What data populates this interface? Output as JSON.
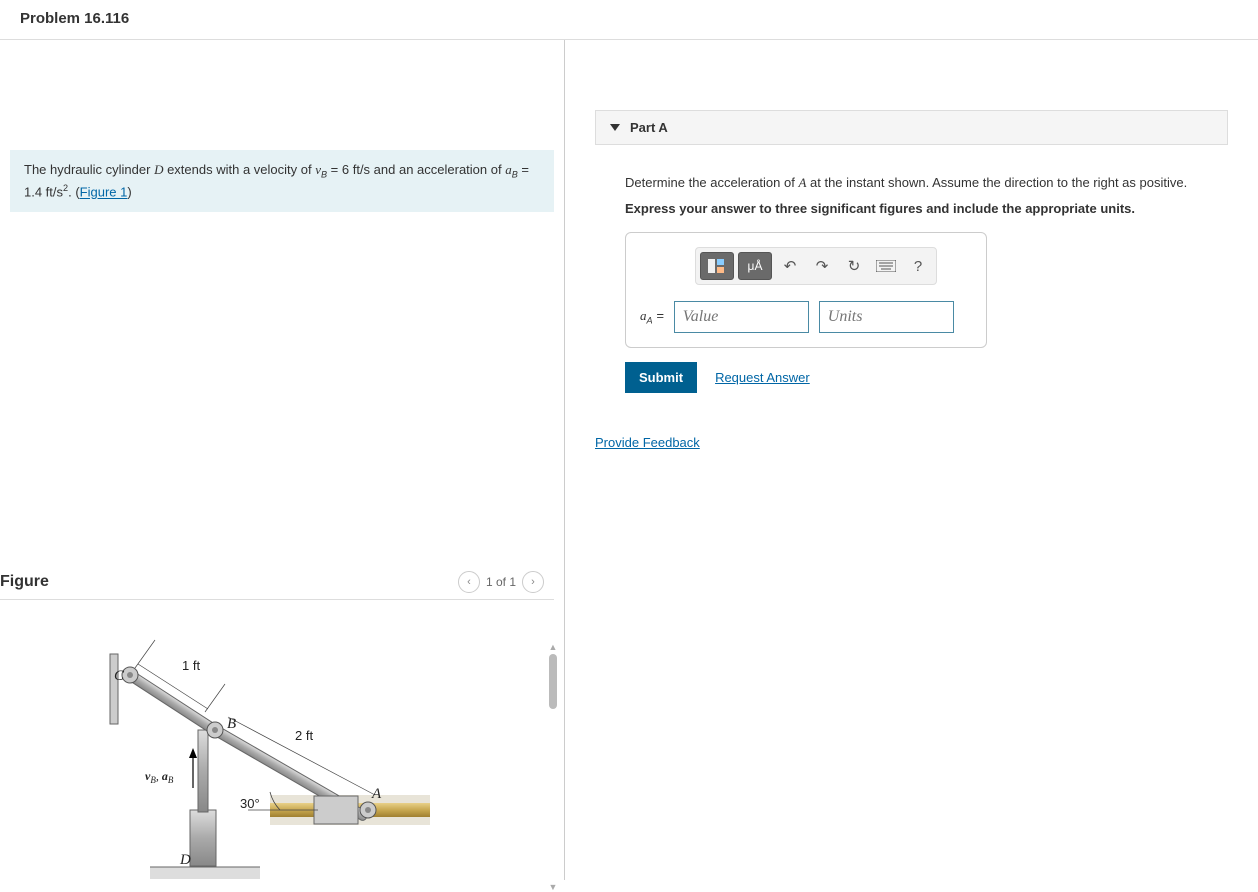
{
  "header": {
    "title": "Problem 16.116"
  },
  "problem": {
    "text_pre": "The hydraulic cylinder ",
    "sym_D": "D",
    "text_mid1": " extends with a velocity of ",
    "sym_vB": "v",
    "sub_B1": "B",
    "eq1": " = 6 ft/s",
    "text_mid2": " and an acceleration of ",
    "sym_aB": "a",
    "sub_B2": "B",
    "eq2": " = 1.4 ft/s",
    "sup2": "2",
    "text_end": ". (",
    "fig_link": "Figure 1",
    "paren": ")"
  },
  "figure": {
    "title": "Figure",
    "counter": "1 of 1",
    "labels": {
      "C": "C",
      "B": "B",
      "A": "A",
      "D": "D",
      "dim1": "1 ft",
      "dim2": "2 ft",
      "angle": "30°",
      "vec_v": "v",
      "vec_a": "a",
      "sub_B": "B",
      "comma": ", "
    }
  },
  "part": {
    "label": "Part A",
    "prompt_pre": "Determine the acceleration of ",
    "prompt_sym": "A",
    "prompt_post": " at the instant shown. Assume the direction to the right as positive.",
    "instruct": "Express your answer to three significant figures and include the appropriate units.",
    "toolbar": {
      "templates_alt": "templates",
      "mua": "μÅ",
      "help": "?"
    },
    "var_a": "a",
    "var_sub": "A",
    "eq": " = ",
    "placeholder_value": "Value",
    "placeholder_units": "Units",
    "submit": "Submit",
    "request": "Request Answer"
  },
  "feedback": {
    "link": "Provide Feedback"
  }
}
